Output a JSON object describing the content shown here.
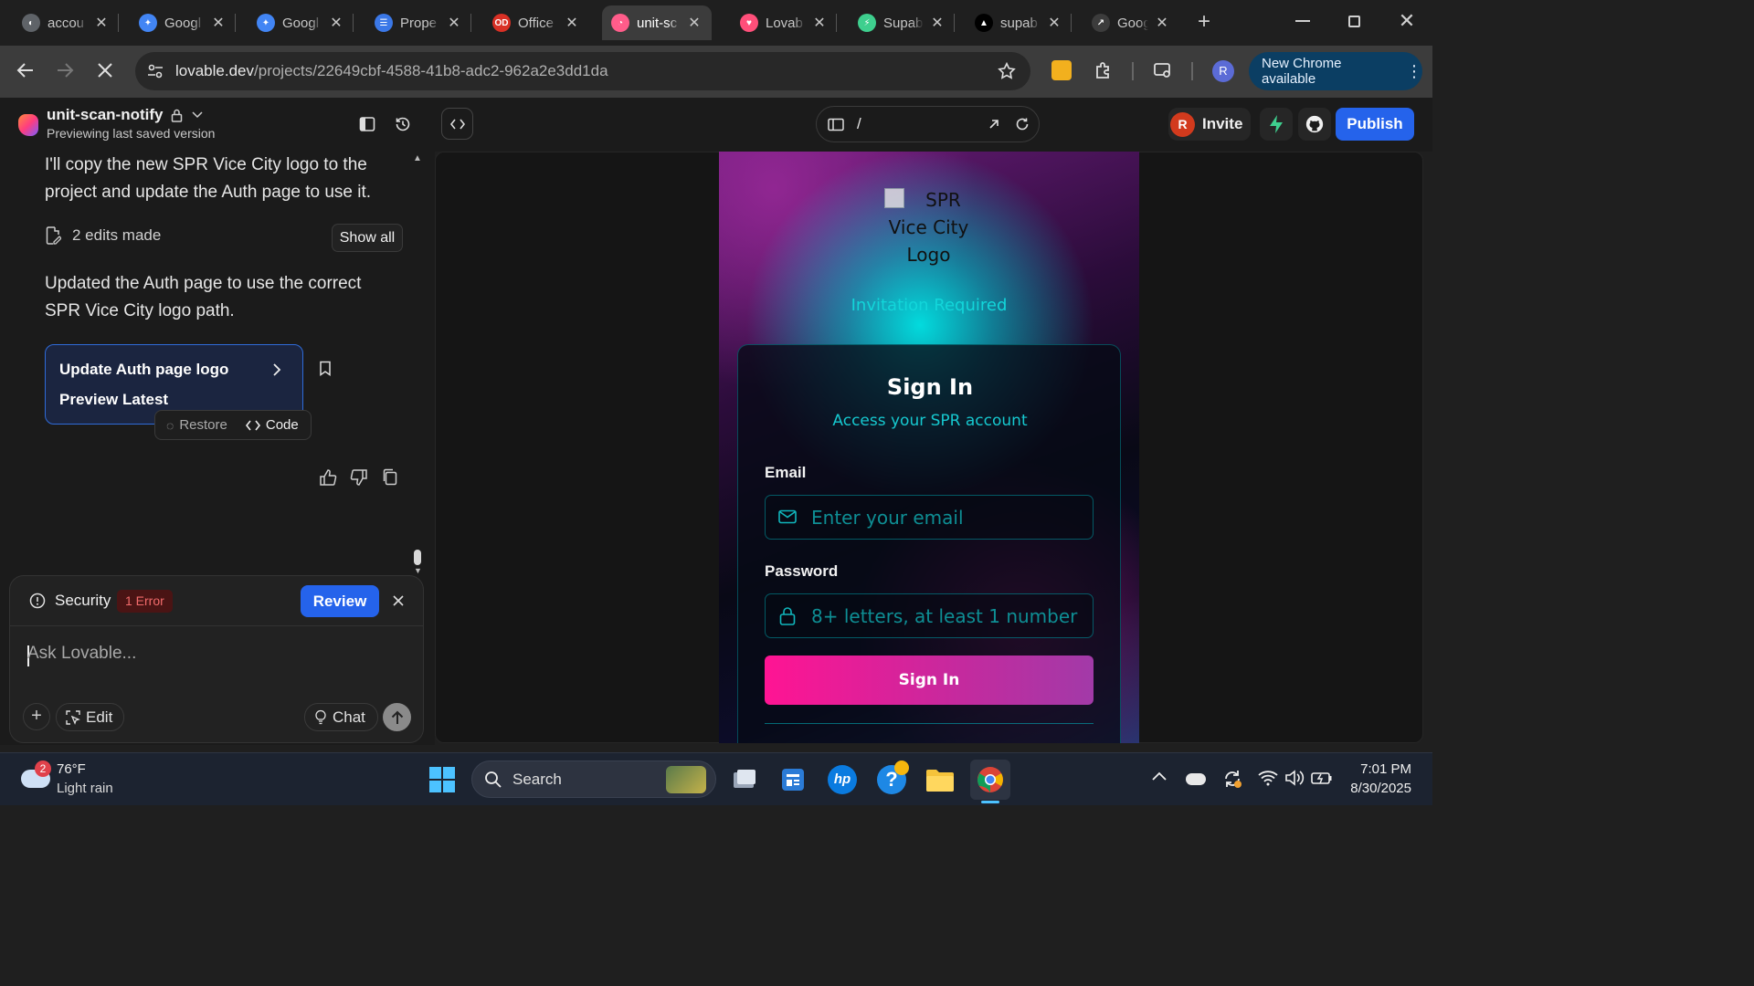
{
  "browser": {
    "tabs": [
      {
        "title": "accou",
        "color": "#5f6368",
        "glyph": "◐"
      },
      {
        "title": "Googl",
        "color": "#4285f4",
        "glyph": "✦"
      },
      {
        "title": "Googl",
        "color": "#4285f4",
        "glyph": "✦"
      },
      {
        "title": "Prope",
        "color": "#3b78e7",
        "glyph": "☰"
      },
      {
        "title": "Office",
        "color": "#d93025",
        "glyph": "OD"
      },
      {
        "title": "unit-sc",
        "color": "#ff5c8a",
        "glyph": "◔"
      },
      {
        "title": "Lovab",
        "color": "#ff4f7a",
        "glyph": "♥"
      },
      {
        "title": "Supab",
        "color": "#3ecf8e",
        "glyph": "⚡"
      },
      {
        "title": "supab",
        "color": "#000000",
        "glyph": "▲"
      },
      {
        "title": "Googl",
        "color": "#3c3c3c",
        "glyph": "↗"
      }
    ],
    "url_host": "lovable.dev",
    "url_path": "/projects/22649cbf-4588-41b8-adc2-962a2e3dd1da",
    "profile_initial": "R",
    "update_label": "New Chrome available"
  },
  "header": {
    "project_name": "unit-scan-notify",
    "subtitle": "Previewing last saved version",
    "path": "/",
    "invite_label": "Invite",
    "invite_avatar": "R",
    "publish_label": "Publish"
  },
  "chat": {
    "message1": "I'll copy the new SPR Vice City logo to the project and update the Auth page to use it.",
    "edits_label": "2 edits made",
    "show_all_label": "Show all",
    "message2": "Updated the Auth page to use the correct SPR Vice City logo path.",
    "card_title": "Update Auth page logo",
    "card_preview": "Preview Latest",
    "restore_label": "Restore",
    "code_label": "Code",
    "security_label": "Security",
    "error_badge": "1 Error",
    "review_label": "Review",
    "input_placeholder": "Ask Lovable...",
    "edit_label": "Edit",
    "chat_label": "Chat"
  },
  "preview": {
    "logo_alt": "SPR Vice City Logo",
    "invitation_text": "Invitation Required",
    "card_title": "Sign In",
    "card_subtitle": "Access your SPR account",
    "email_label": "Email",
    "email_placeholder": "Enter your email",
    "password_label": "Password",
    "password_placeholder": "8+ letters, at least 1 number",
    "signin_button": "Sign In"
  },
  "taskbar": {
    "weather_temp": "76°F",
    "weather_desc": "Light rain",
    "weather_badge": "2",
    "search_label": "Search",
    "time": "7:01 PM",
    "date": "8/30/2025"
  }
}
